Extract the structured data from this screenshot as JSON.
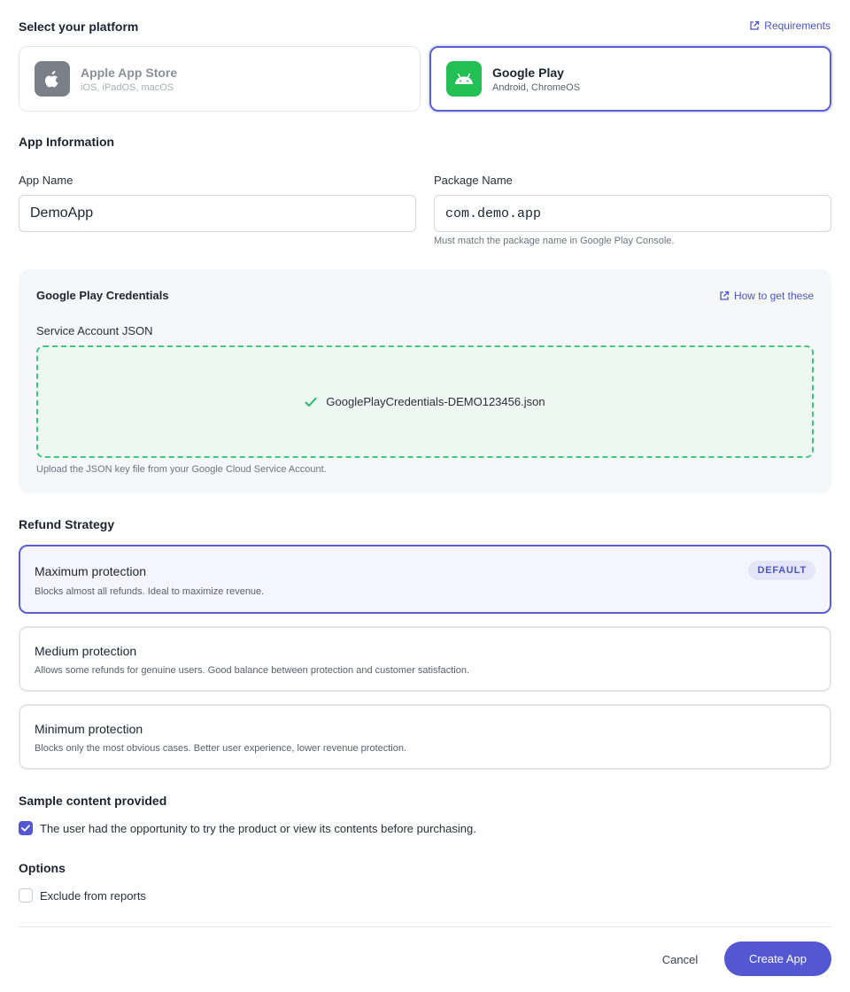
{
  "platform": {
    "section_title": "Select your platform",
    "requirements_link": "Requirements",
    "options": [
      {
        "name": "Apple App Store",
        "subtitle": "iOS, iPadOS, macOS",
        "selected": false
      },
      {
        "name": "Google Play",
        "subtitle": "Android, ChromeOS",
        "selected": true
      }
    ]
  },
  "app_info": {
    "section_title": "App Information",
    "app_name_label": "App Name",
    "app_name_value": "DemoApp",
    "package_label": "Package Name",
    "package_value": "com.demo.app",
    "package_helper": "Must match the package name in Google Play Console."
  },
  "credentials": {
    "title": "Google Play Credentials",
    "help_link": "How to get these",
    "field_label": "Service Account JSON",
    "uploaded_file": "GooglePlayCredentials-DEMO123456.json",
    "helper": "Upload the JSON key file from your Google Cloud Service Account."
  },
  "refund": {
    "section_title": "Refund Strategy",
    "default_badge": "DEFAULT",
    "options": [
      {
        "title": "Maximum protection",
        "description": "Blocks almost all refunds. Ideal to maximize revenue.",
        "selected": true
      },
      {
        "title": "Medium protection",
        "description": "Allows some refunds for genuine users. Good balance between protection and customer satisfaction.",
        "selected": false
      },
      {
        "title": "Minimum protection",
        "description": "Blocks only the most obvious cases. Better user experience, lower revenue protection.",
        "selected": false
      }
    ]
  },
  "sample": {
    "section_title": "Sample content provided",
    "checkbox_label": "The user had the opportunity to try the product or view its contents before purchasing.",
    "checked": true
  },
  "options": {
    "section_title": "Options",
    "exclude_label": "Exclude from reports",
    "checked": false
  },
  "footer": {
    "cancel_label": "Cancel",
    "create_label": "Create App"
  },
  "colors": {
    "accent": "#5357d1",
    "android_green": "#22bf55",
    "upload_green": "#3fc77f"
  }
}
